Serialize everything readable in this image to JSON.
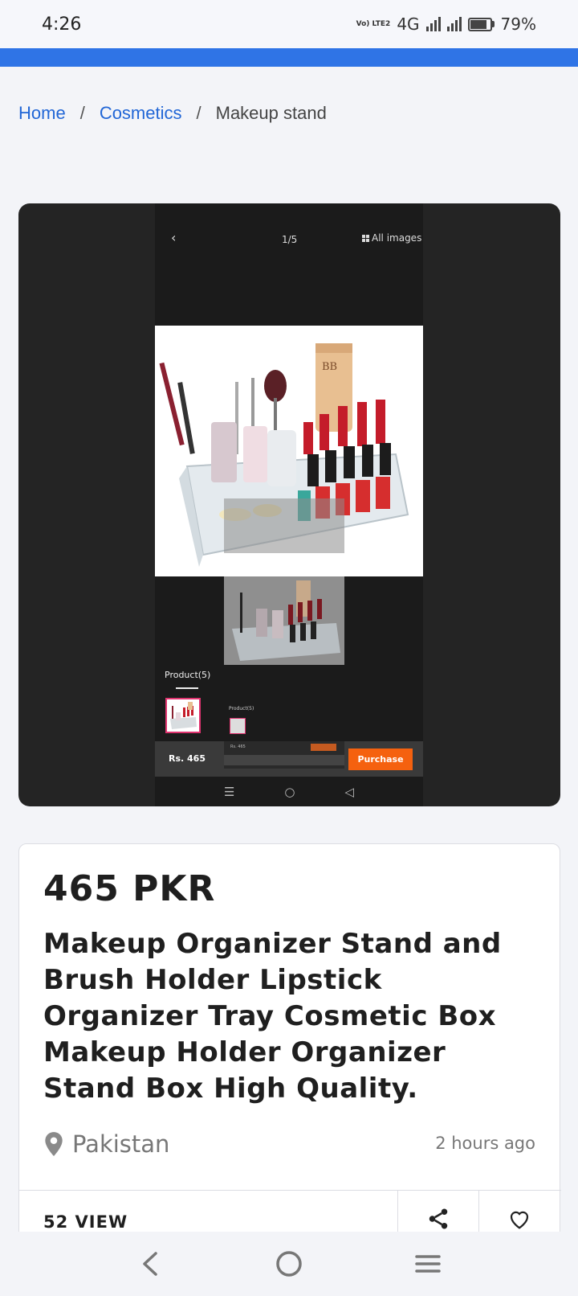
{
  "status_bar": {
    "time": "4:26",
    "lte_label": "Vo) LTE2",
    "network": "4G",
    "battery": "79%"
  },
  "breadcrumb": {
    "home": "Home",
    "separator": "/",
    "category": "Cosmetics",
    "current": "Makeup stand"
  },
  "gallery": {
    "counter": "1/5",
    "all_images": "All images",
    "product_tab": "Product(5)",
    "mini_label": "Product(5)",
    "price": "Rs. 465",
    "mini_price": "Rs. 465",
    "purchase": "Purchase"
  },
  "listing": {
    "price": "465 PKR",
    "title": "Makeup Organizer Stand and Brush Holder Lipstick Organizer Tray Cosmetic Box Makeup Holder Organizer Stand Box High Quality.",
    "location": "Pakistan",
    "posted": "2 hours ago",
    "views": "52 VIEW"
  },
  "colors": {
    "accent_blue": "#2f74e6",
    "link_blue": "#2166d6",
    "purchase_orange": "#f5610f"
  },
  "icons": [
    "location-pin-icon",
    "share-icon",
    "heart-icon",
    "back-icon",
    "home-icon",
    "recents-icon"
  ]
}
